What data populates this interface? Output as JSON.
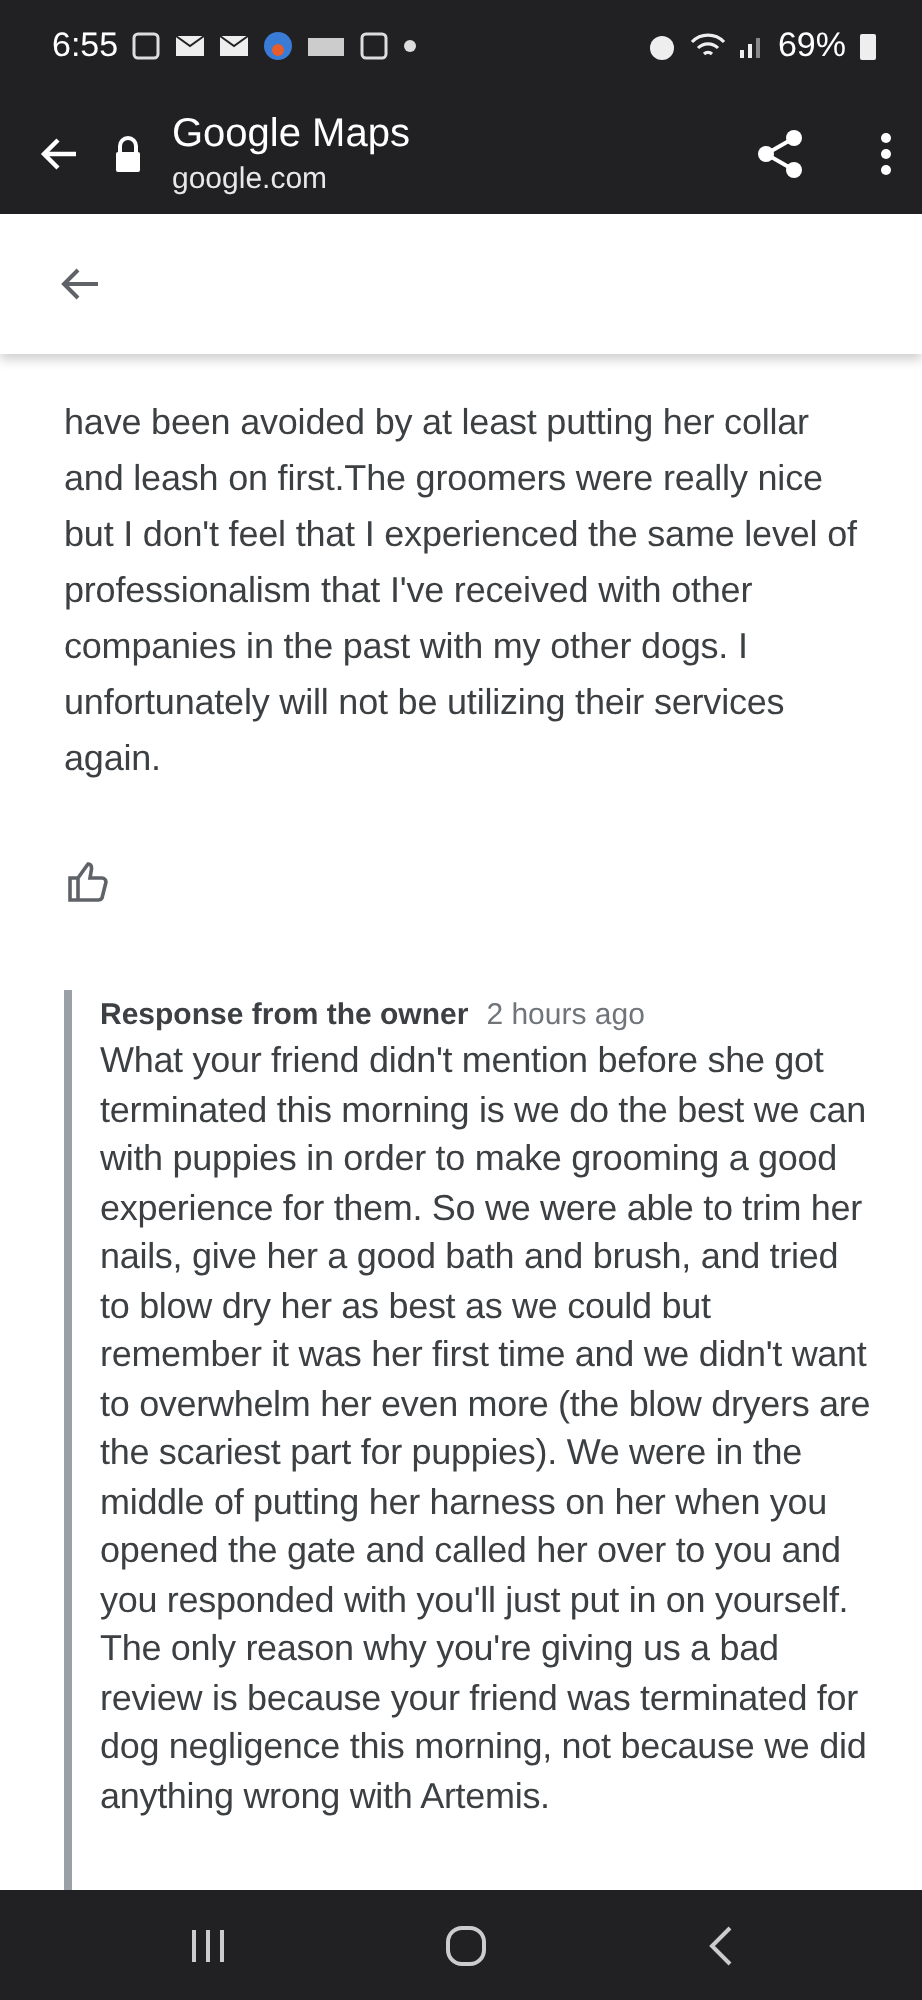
{
  "status_bar": {
    "time": "6:55",
    "battery": "69%"
  },
  "app_bar": {
    "title": "Google Maps",
    "url": "google.com"
  },
  "review": {
    "text": "have been avoided by at least putting her collar and leash on first.The groomers were really nice but I don't feel that I experienced the same level of professionalism that I've received with other companies in the past with my other dogs. I unfortunately will not be utilizing their services again.",
    "liked": false
  },
  "owner_response": {
    "label": "Response from the owner",
    "time": "2 hours ago",
    "text": "What your friend didn't mention before she got terminated this morning is we do the best we can with puppies in order to make grooming a good experience for them. So we were able to trim her nails, give her a good bath and brush, and tried to blow dry her as best as we could but remember it was her first time and we didn't want to overwhelm her even more (the blow dryers are the scariest part for puppies). We were in the middle of putting her harness on her when you opened the gate and called her over to you and you responded with you'll just put in on yourself. The only reason why you're giving us a bad review is because your friend was terminated for dog negligence this morning, not because we did anything wrong with Artemis."
  }
}
